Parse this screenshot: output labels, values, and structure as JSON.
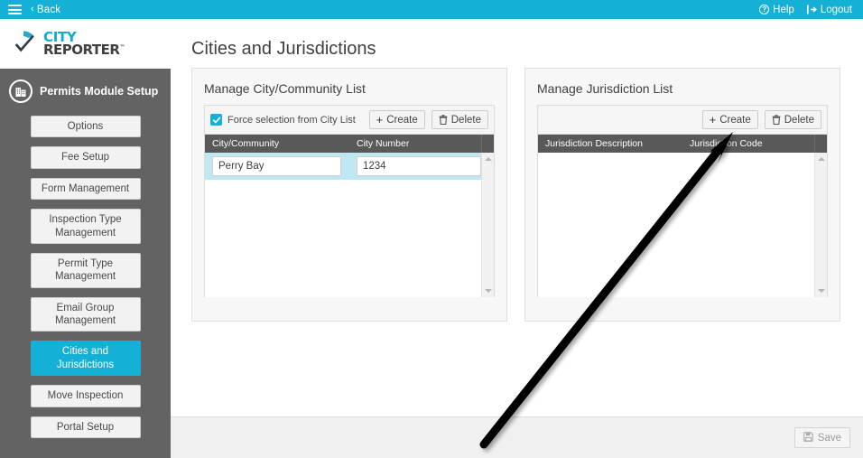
{
  "topbar": {
    "menu_icon": "hamburger-icon",
    "back_label": "Back",
    "back_chevron": "‹",
    "help_label": "Help",
    "help_icon": "question-circle-icon",
    "logout_label": "Logout",
    "logout_icon": "logout-arrow-icon",
    "bg_color": "#15b0d6"
  },
  "logo": {
    "line1": "CITY",
    "line2": "REPORTER",
    "tm": "™"
  },
  "sidebar": {
    "module_title": "Permits Module Setup",
    "module_icon": "building-icon",
    "bg_color": "#636363",
    "active_color": "#15b0d6",
    "items": [
      {
        "label": "Options",
        "active": false
      },
      {
        "label": "Fee Setup",
        "active": false
      },
      {
        "label": "Form Management",
        "active": false
      },
      {
        "label": "Inspection Type Management",
        "active": false
      },
      {
        "label": "Permit Type Management",
        "active": false
      },
      {
        "label": "Email Group Management",
        "active": false
      },
      {
        "label": "Cities and Jurisdictions",
        "active": true
      },
      {
        "label": "Move Inspection",
        "active": false
      },
      {
        "label": "Portal Setup",
        "active": false
      }
    ]
  },
  "main": {
    "page_title": "Cities and Jurisdictions",
    "city_panel": {
      "title": "Manage City/Community List",
      "checkbox": {
        "label": "Force selection from City List",
        "checked": true
      },
      "create_label": "Create",
      "create_icon": "plus-icon",
      "delete_label": "Delete",
      "delete_icon": "trash-icon",
      "columns": [
        "City/Community",
        "City Number"
      ],
      "rows": [
        {
          "city_community": "Perry Bay",
          "city_number": "1234",
          "selected": true
        }
      ]
    },
    "jurisdiction_panel": {
      "title": "Manage Jurisdiction List",
      "create_label": "Create",
      "create_icon": "plus-icon",
      "delete_label": "Delete",
      "delete_icon": "trash-icon",
      "columns": [
        "Jurisdiction Description",
        "Jurisdiction Code"
      ],
      "rows": []
    }
  },
  "footer": {
    "save_label": "Save",
    "save_icon": "floppy-disk-icon",
    "save_disabled": true
  },
  "annotation": {
    "type": "arrow",
    "points_to": "jurisdiction-create-button",
    "color": "#000000"
  }
}
